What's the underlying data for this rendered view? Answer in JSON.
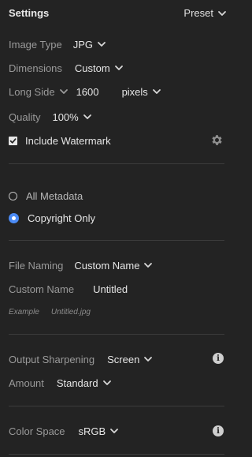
{
  "header": {
    "title": "Settings",
    "preset_label": "Preset"
  },
  "image_type": {
    "label": "Image Type",
    "value": "JPG"
  },
  "dimensions": {
    "label": "Dimensions",
    "value": "Custom"
  },
  "long_side": {
    "label": "Long Side",
    "value": "1600",
    "unit": "pixels"
  },
  "quality": {
    "label": "Quality",
    "value": "100%"
  },
  "watermark": {
    "label": "Include Watermark",
    "checked": true
  },
  "metadata": {
    "options": [
      {
        "label": "All Metadata",
        "selected": false
      },
      {
        "label": "Copyright Only",
        "selected": true
      }
    ]
  },
  "file_naming": {
    "label": "File Naming",
    "value": "Custom Name"
  },
  "custom_name": {
    "label": "Custom Name",
    "value": "Untitled"
  },
  "example": {
    "label": "Example",
    "value": "Untitled.jpg"
  },
  "output_sharpening": {
    "label": "Output Sharpening",
    "value": "Screen"
  },
  "amount": {
    "label": "Amount",
    "value": "Standard"
  },
  "color_space": {
    "label": "Color Space",
    "value": "sRGB"
  },
  "colors": {
    "accent": "#4b8bf5",
    "background": "#232323",
    "divider": "#3c3c3c"
  }
}
